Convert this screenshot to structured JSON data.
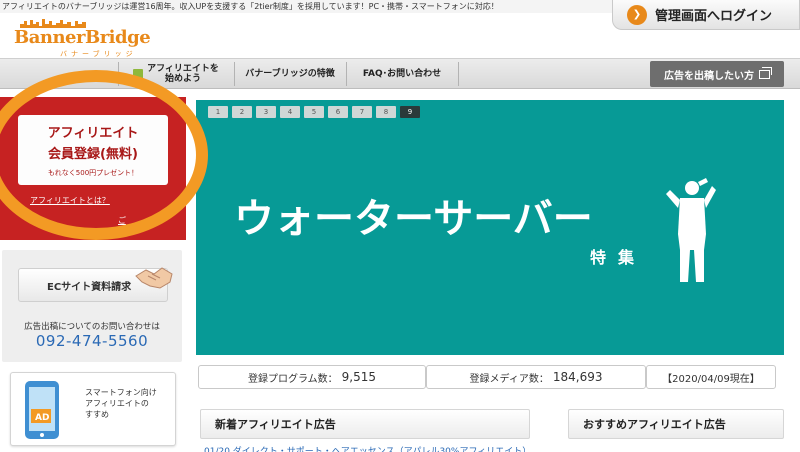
{
  "top_notice": "アフィリエイトのバナーブリッジは運営16周年。収入UPを支援する「2tier制度」を採用しています！PC・携帯・スマートフォンに対応！",
  "login_button": "管理画面へログイン",
  "logo": {
    "name": "BannerBridge",
    "kana": "バナーブリッジ"
  },
  "nav": {
    "items": [
      {
        "line1": "アフィリエイトを",
        "line2": "始めよう"
      },
      {
        "line1": "バナーブリッジの特徴"
      },
      {
        "line1": "FAQ･お問い合わせ"
      }
    ],
    "ad_button": "広告を出稿したい方"
  },
  "register": {
    "title1": "アフィリエイト",
    "title2": "会員登録(無料)",
    "promo": "もれなく500円プレゼント！",
    "link": "アフィリエイトとは？",
    "link2": "ご"
  },
  "ec": {
    "button": "ECサイト資料請求",
    "note": "広告出稿についてのお問い合わせは",
    "phone": "092-474-5560"
  },
  "smartphone": {
    "icon_label": "AD",
    "line1": "スマートフォン向け",
    "line2": "アフィリエイトの",
    "line3": "すすめ"
  },
  "banner": {
    "pages": [
      "1",
      "2",
      "3",
      "4",
      "5",
      "6",
      "7",
      "8",
      "9"
    ],
    "active_page": "9",
    "title": "ウォーターサーバー",
    "subtitle": "特集",
    "bg_color": "#079a96"
  },
  "stats": {
    "programs_label": "登録プログラム数：",
    "programs_value": "9,515",
    "media_label": "登録メディア数：",
    "media_value": "184,693",
    "as_of": "【2020/04/09現在】"
  },
  "sections": {
    "new_ads": "新着アフィリエイト広告",
    "recommended": "おすすめアフィリエイト広告",
    "news_peek": "01/20 ダイレクト・サポート・ヘアエッセンス（アパレル30%アフィリエイト）"
  },
  "colors": {
    "accent": "#e8891a",
    "register_bg": "#c62222",
    "link": "#2a69b5",
    "highlight_ring": "#f39a24"
  }
}
